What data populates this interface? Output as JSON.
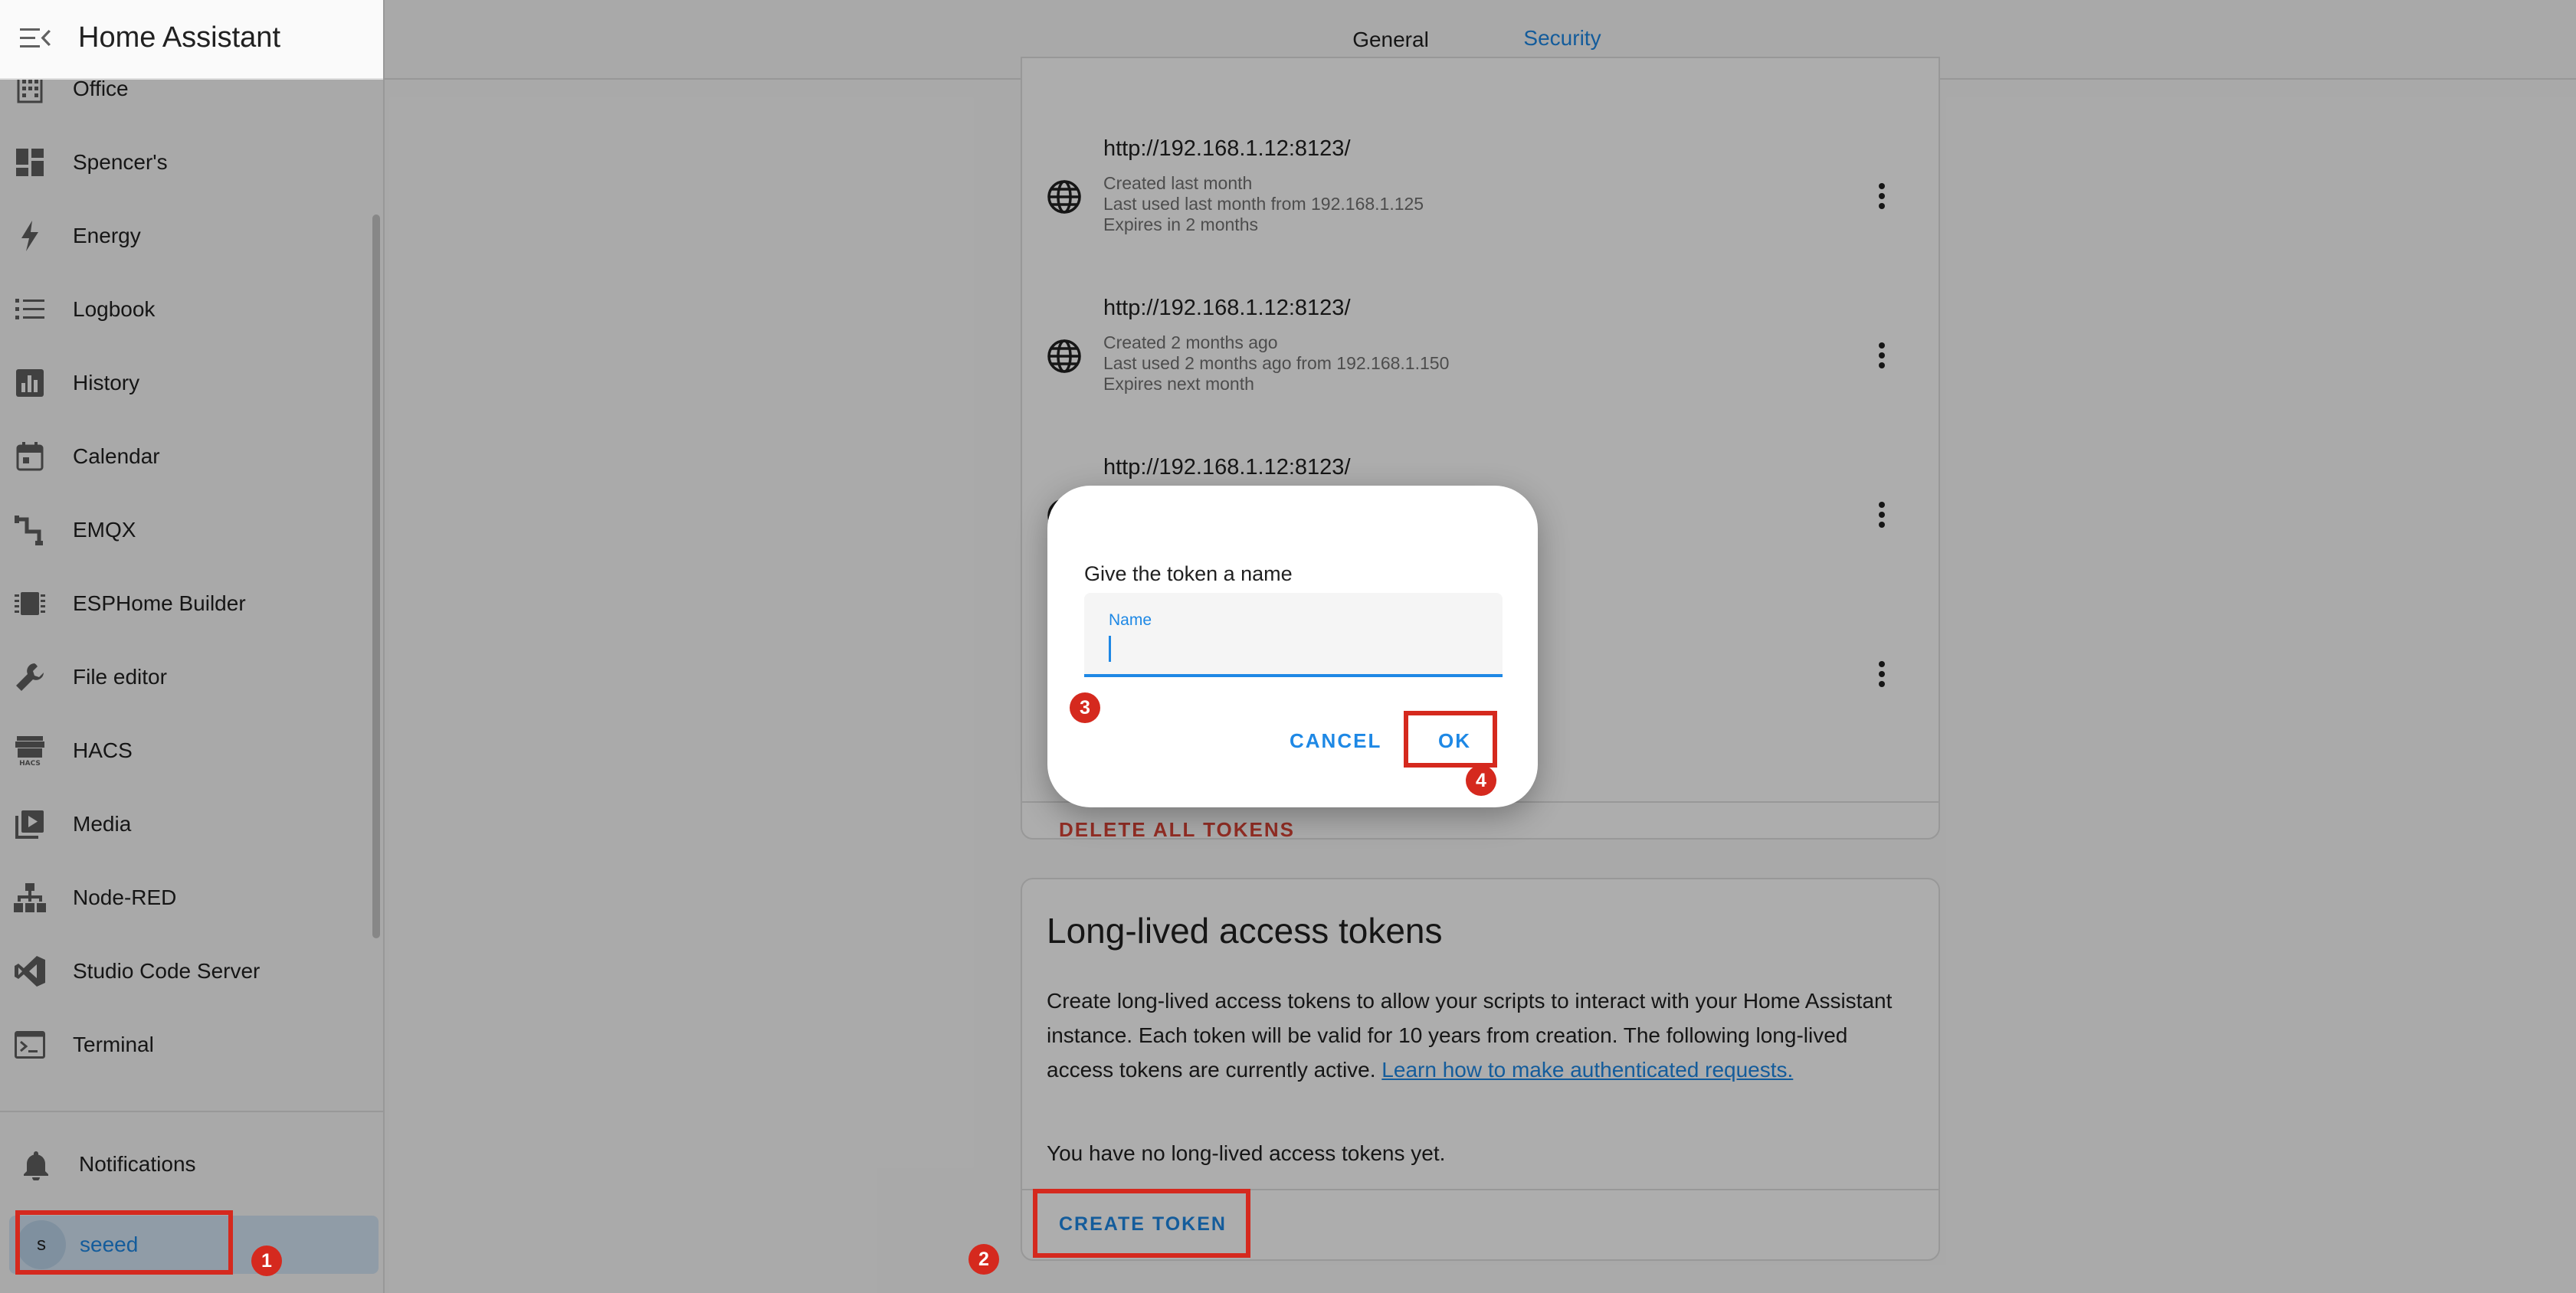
{
  "sidebar": {
    "app_title": "Home Assistant",
    "items": [
      {
        "label": "Office",
        "icon": "office-building-icon"
      },
      {
        "label": "Spencer's",
        "icon": "dashboard-icon"
      },
      {
        "label": "Energy",
        "icon": "lightning-bolt-icon"
      },
      {
        "label": "Logbook",
        "icon": "format-list-icon"
      },
      {
        "label": "History",
        "icon": "chart-box-icon"
      },
      {
        "label": "Calendar",
        "icon": "calendar-icon"
      },
      {
        "label": "EMQX",
        "icon": "pipe-icon"
      },
      {
        "label": "ESPHome Builder",
        "icon": "chip-icon"
      },
      {
        "label": "File editor",
        "icon": "wrench-icon"
      },
      {
        "label": "HACS",
        "icon": "hacs-store-icon"
      },
      {
        "label": "Media",
        "icon": "play-box-multiple-icon"
      },
      {
        "label": "Node-RED",
        "icon": "sitemap-icon"
      },
      {
        "label": "Studio Code Server",
        "icon": "microsoft-visual-studio-code-icon"
      },
      {
        "label": "Terminal",
        "icon": "console-icon"
      }
    ],
    "notifications_label": "Notifications",
    "user": {
      "initial": "s",
      "name": "seeed"
    }
  },
  "tabs": [
    {
      "label": "General",
      "active": false
    },
    {
      "label": "Security",
      "active": true
    }
  ],
  "refresh_tokens": {
    "rows": [
      {
        "url": "http://192.168.1.12:8123/",
        "created": "Created last month",
        "last_used": "Last used last month from 192.168.1.125",
        "expires": "Expires in 2 months"
      },
      {
        "url": "http://192.168.1.12:8123/",
        "created": "Created 2 months ago",
        "last_used": "Last used 2 months ago from 192.168.1.150",
        "expires": "Expires next month"
      },
      {
        "url": "http://192.168.1.12:8123/"
      }
    ],
    "delete_all_label": "DELETE ALL TOKENS"
  },
  "long_lived": {
    "title": "Long-lived access tokens",
    "description": "Create long-lived access tokens to allow your scripts to interact with your Home Assistant instance. Each token will be valid for 10 years from creation. The following long-lived access tokens are currently active.",
    "link_text": "Learn how to make authenticated requests.",
    "empty_text": "You have no long-lived access tokens yet.",
    "create_label": "CREATE TOKEN"
  },
  "dialog": {
    "prompt": "Give the token a name",
    "field_label": "Name",
    "field_value": "",
    "cancel_label": "CANCEL",
    "ok_label": "OK"
  },
  "annotations": {
    "badge_1": "1",
    "badge_2": "2",
    "badge_3": "3",
    "badge_4": "4",
    "color": "#d5291e"
  },
  "colors": {
    "accent": "#1e88e5",
    "danger": "#db4437",
    "annotation": "#d5291e"
  }
}
